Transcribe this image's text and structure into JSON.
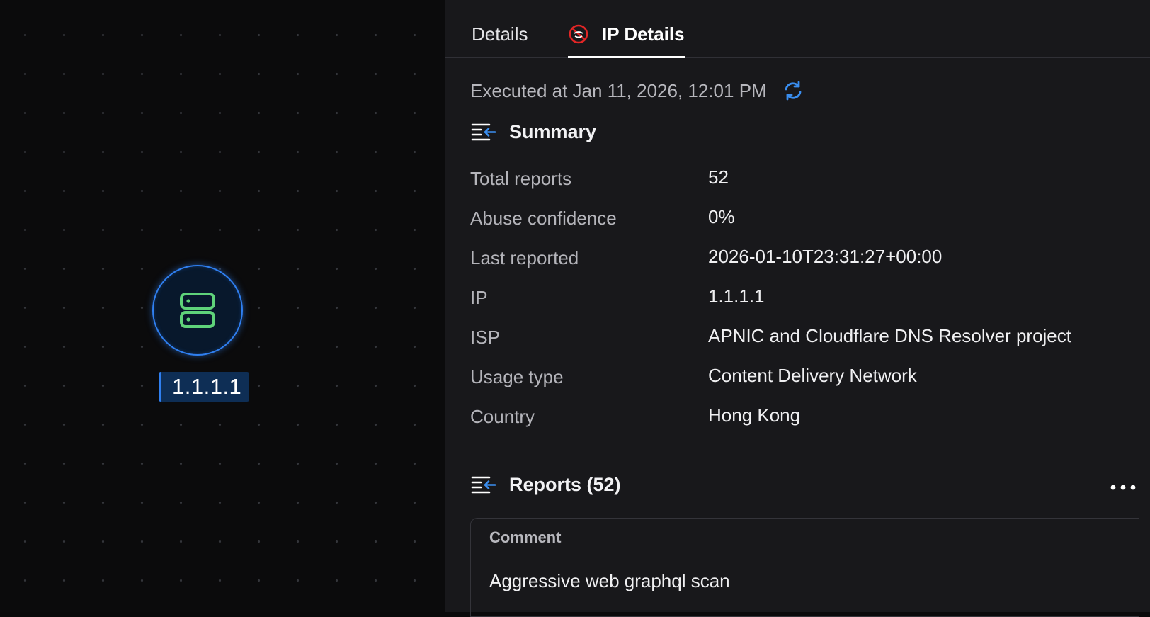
{
  "canvas": {
    "node": {
      "label": "1.1.1.1",
      "icon": "server-icon",
      "ring_color": "#2f7ff0",
      "icon_color": "#5fd37a"
    }
  },
  "panel": {
    "tabs": [
      {
        "label": "Details",
        "active": false
      },
      {
        "label": "IP Details",
        "active": true,
        "icon": "abuseipdb-icon"
      }
    ],
    "executed_text": "Executed at Jan 11, 2026, 12:01 PM",
    "summary": {
      "title": "Summary",
      "rows": [
        {
          "key": "Total reports",
          "value": "52"
        },
        {
          "key": "Abuse confidence",
          "value": "0%"
        },
        {
          "key": "Last reported",
          "value": "2026-01-10T23:31:27+00:00"
        },
        {
          "key": "IP",
          "value": "1.1.1.1"
        },
        {
          "key": "ISP",
          "value": "APNIC and Cloudflare DNS Resolver project"
        },
        {
          "key": "Usage type",
          "value": "Content Delivery Network"
        },
        {
          "key": "Country",
          "value": "Hong Kong"
        }
      ]
    },
    "reports": {
      "title": "Reports (52)",
      "columns": [
        "Comment"
      ],
      "rows": [
        [
          "Aggressive web graphql scan"
        ]
      ]
    }
  },
  "colors": {
    "accent": "#2f7ff0",
    "panel_bg": "#18181b",
    "canvas_bg": "#0b0b0c"
  }
}
